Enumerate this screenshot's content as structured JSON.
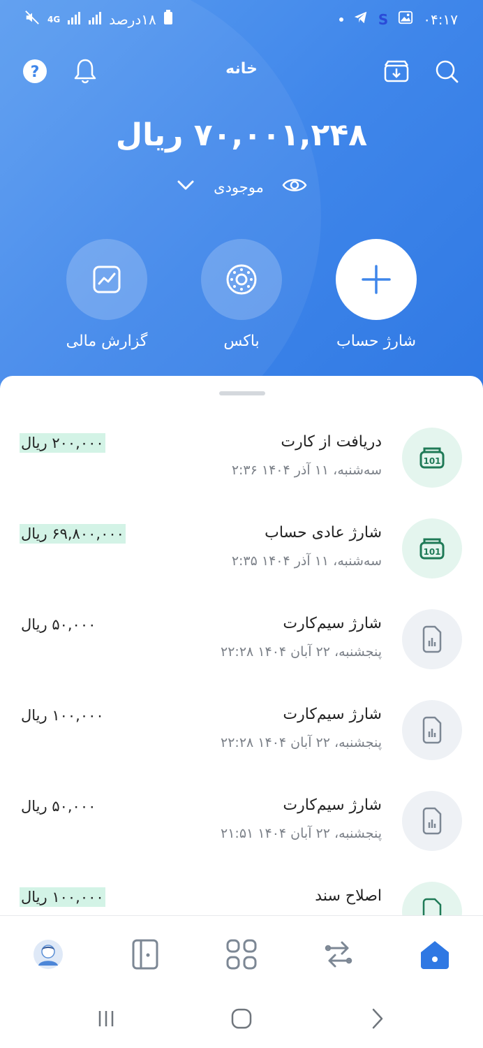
{
  "status_bar": {
    "time": "۰۴:۱۷",
    "battery_text": "۱۸درصد",
    "network": "4G"
  },
  "header": {
    "title": "خانه",
    "balance": "۷۰,۰۰۱,۲۴۸ ریال",
    "balance_label": "موجودی"
  },
  "actions": [
    {
      "label": "شارژ حساب",
      "icon": "plus-icon"
    },
    {
      "label": "باکس",
      "icon": "box-icon"
    },
    {
      "label": "گزارش مالی",
      "icon": "chart-icon"
    }
  ],
  "transactions": [
    {
      "title": "دریافت از کارت",
      "date": "سه‌شنبه، ۱۱ آذر ۱۴۰۴ ۲:۳۶",
      "amount": "۲۰۰,۰۰۰ ریال",
      "highlight": true,
      "icon": "cash-icon"
    },
    {
      "title": "شارژ عادی حساب",
      "date": "سه‌شنبه، ۱۱ آذر ۱۴۰۴ ۲:۳۵",
      "amount": "۶۹,۸۰۰,۰۰۰ ریال",
      "highlight": true,
      "icon": "cash-icon"
    },
    {
      "title": "شارژ سیم‌کارت",
      "date": "پنجشنبه، ۲۲ آبان ۱۴۰۴ ۲۲:۲۸",
      "amount": "۵۰,۰۰۰ ریال",
      "highlight": false,
      "icon": "sim-icon"
    },
    {
      "title": "شارژ سیم‌کارت",
      "date": "پنجشنبه، ۲۲ آبان ۱۴۰۴ ۲۲:۲۸",
      "amount": "۱۰۰,۰۰۰ ریال",
      "highlight": false,
      "icon": "sim-icon"
    },
    {
      "title": "شارژ سیم‌کارت",
      "date": "پنجشنبه، ۲۲ آبان ۱۴۰۴ ۲۱:۵۱",
      "amount": "۵۰,۰۰۰ ریال",
      "highlight": false,
      "icon": "sim-icon"
    },
    {
      "title": "اصلاح سند",
      "date": "",
      "amount": "۱۰۰,۰۰۰ ریال",
      "highlight": true,
      "icon": "document-icon"
    }
  ],
  "colors": {
    "header_blue": "#3f86ea",
    "highlight_green": "#d3f3e6",
    "cash_icon_green": "#1f7a57",
    "nav_active_blue": "#2f78e3",
    "nav_icon_gray": "#7c8794"
  }
}
